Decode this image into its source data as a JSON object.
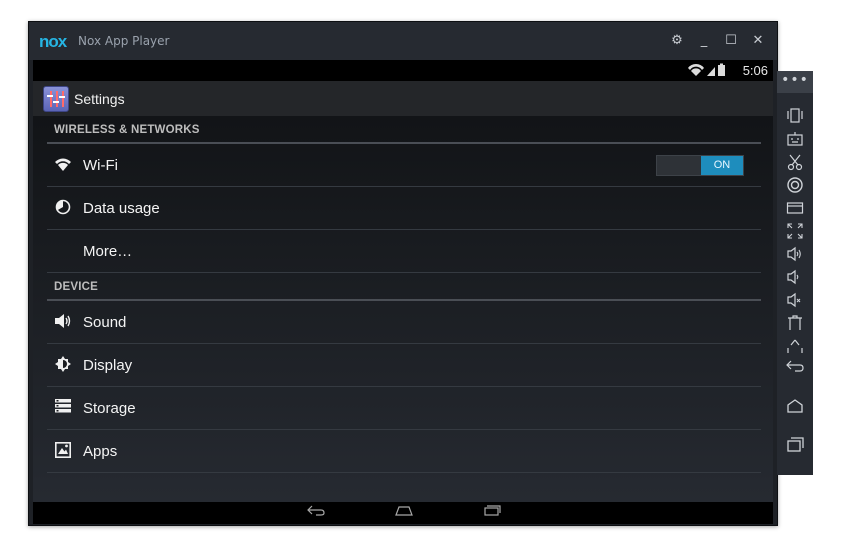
{
  "window": {
    "logo": "nox",
    "title": "Nox App Player",
    "controls": [
      "gear-icon",
      "minimize-icon",
      "maximize-icon",
      "close-icon"
    ]
  },
  "status_bar": {
    "icons": [
      "wifi-icon",
      "signal-icon",
      "battery-icon"
    ],
    "time": "5:06"
  },
  "action_bar": {
    "app_icon": "settings-app-icon",
    "title": "Settings"
  },
  "sections": [
    {
      "header": "WIRELESS & NETWORKS",
      "items": [
        {
          "label": "Wi-Fi",
          "icon": "wifi-icon",
          "toggle": "ON"
        },
        {
          "label": "Data usage",
          "icon": "data-usage-icon"
        },
        {
          "label": "More…",
          "icon": ""
        }
      ]
    },
    {
      "header": "DEVICE",
      "items": [
        {
          "label": "Sound",
          "icon": "sound-icon"
        },
        {
          "label": "Display",
          "icon": "display-icon"
        },
        {
          "label": "Storage",
          "icon": "storage-icon"
        },
        {
          "label": "Apps",
          "icon": "apps-icon"
        }
      ]
    }
  ],
  "nav_bar": [
    "back-icon",
    "home-icon",
    "recents-icon"
  ],
  "toolbar": {
    "menu": "•••",
    "tools": [
      "shake-icon",
      "keyboard-mapping-icon",
      "scissors-icon",
      "record-icon",
      "screen-icon",
      "fullscreen-icon",
      "volume-up-icon",
      "volume-down-icon",
      "mute-icon",
      "clean-icon",
      "upload-icon",
      "back-icon",
      "home-icon",
      "recents-icon"
    ]
  },
  "colors": {
    "accent": "#1e8dbd",
    "logo": "#26b5e3"
  }
}
